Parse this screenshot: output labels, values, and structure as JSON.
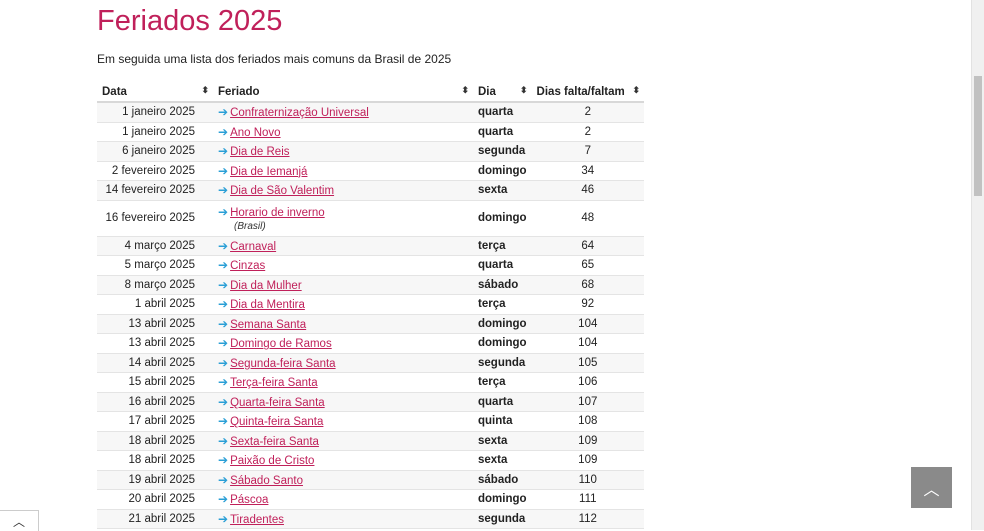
{
  "page": {
    "title": "Feriados 2025",
    "intro": "Em seguida uma lista dos feriados mais comuns da Brasil de 2025"
  },
  "table": {
    "headers": [
      "Data",
      "Feriado",
      "Dia",
      "Dias falta/faltam"
    ],
    "sort_icon": "sort-icon",
    "rows": [
      {
        "date": "1 janeiro 2025",
        "holiday": "Confraternização Universal",
        "day": "quarta",
        "days": "2"
      },
      {
        "date": "1 janeiro 2025",
        "holiday": "Ano Novo",
        "day": "quarta",
        "days": "2"
      },
      {
        "date": "6 janeiro 2025",
        "holiday": "Dia de Reis",
        "day": "segunda",
        "days": "7"
      },
      {
        "date": "2 fevereiro 2025",
        "holiday": "Dia de Iemanjá",
        "day": "domingo",
        "days": "34"
      },
      {
        "date": "14 fevereiro 2025",
        "holiday": "Dia de São Valentim",
        "day": "sexta",
        "days": "46"
      },
      {
        "date": "16 fevereiro 2025",
        "holiday": "Horario de inverno",
        "note": "(Brasil)",
        "day": "domingo",
        "days": "48"
      },
      {
        "date": "4 março 2025",
        "holiday": "Carnaval",
        "day": "terça",
        "days": "64"
      },
      {
        "date": "5 março 2025",
        "holiday": "Cinzas",
        "day": "quarta",
        "days": "65"
      },
      {
        "date": "8 março 2025",
        "holiday": "Dia da Mulher",
        "day": "sábado",
        "days": "68"
      },
      {
        "date": "1 abril 2025",
        "holiday": "Dia da Mentira",
        "day": "terça",
        "days": "92"
      },
      {
        "date": "13 abril 2025",
        "holiday": "Semana Santa",
        "day": "domingo",
        "days": "104"
      },
      {
        "date": "13 abril 2025",
        "holiday": "Domingo de Ramos",
        "day": "domingo",
        "days": "104"
      },
      {
        "date": "14 abril 2025",
        "holiday": "Segunda-feira Santa",
        "day": "segunda",
        "days": "105"
      },
      {
        "date": "15 abril 2025",
        "holiday": "Terça-feira Santa",
        "day": "terça",
        "days": "106"
      },
      {
        "date": "16 abril 2025",
        "holiday": "Quarta-feira Santa",
        "day": "quarta",
        "days": "107"
      },
      {
        "date": "17 abril 2025",
        "holiday": "Quinta-feira Santa",
        "day": "quinta",
        "days": "108"
      },
      {
        "date": "18 abril 2025",
        "holiday": "Sexta-feira Santa",
        "day": "sexta",
        "days": "109"
      },
      {
        "date": "18 abril 2025",
        "holiday": "Paixão de Cristo",
        "day": "sexta",
        "days": "109"
      },
      {
        "date": "19 abril 2025",
        "holiday": "Sábado Santo",
        "day": "sábado",
        "days": "110"
      },
      {
        "date": "20 abril 2025",
        "holiday": "Páscoa",
        "day": "domingo",
        "days": "111"
      },
      {
        "date": "21 abril 2025",
        "holiday": "Tiradentes",
        "day": "segunda",
        "days": "112"
      }
    ]
  },
  "controls": {
    "back_to_top_icon": "chevron-up-icon",
    "bottom_tab_icon": "chevron-up-icon"
  },
  "colors": {
    "accent": "#c0205a",
    "arrow": "#2a9fd6"
  }
}
